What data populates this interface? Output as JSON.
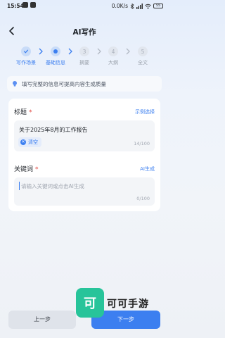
{
  "status_bar": {
    "time": "15:54",
    "network_speed": "0.0K/s",
    "battery": "55"
  },
  "header": {
    "title": "AI写作"
  },
  "stepper": [
    {
      "number": "✓",
      "label": "写作场景",
      "state": "done"
    },
    {
      "number": "●",
      "label": "基础信息",
      "state": "active"
    },
    {
      "number": "3",
      "label": "摘要",
      "state": "pending"
    },
    {
      "number": "4",
      "label": "大纲",
      "state": "pending"
    },
    {
      "number": "5",
      "label": "全文",
      "state": "pending"
    }
  ],
  "tip": {
    "text": "填写完整的信息可提高内容生成质量"
  },
  "form": {
    "title_field": {
      "label": "标题",
      "required_mark": "*",
      "action_link": "示例选择",
      "value": "关于2025年8月的工作报告",
      "clear_label": "清空",
      "counter": "14/100"
    },
    "keyword_field": {
      "label": "关键词",
      "required_mark": "*",
      "action_link": "AI生成",
      "placeholder": "请输入关键词或点击AI生成",
      "counter": "0/100"
    }
  },
  "footer": {
    "prev_label": "上一步",
    "next_label": "下一步"
  },
  "watermark": {
    "logo_char": "可",
    "text": "可可手游"
  },
  "colors": {
    "accent": "#3c7ff0",
    "required": "#e0443d",
    "watermark_green": "#27c49a"
  }
}
